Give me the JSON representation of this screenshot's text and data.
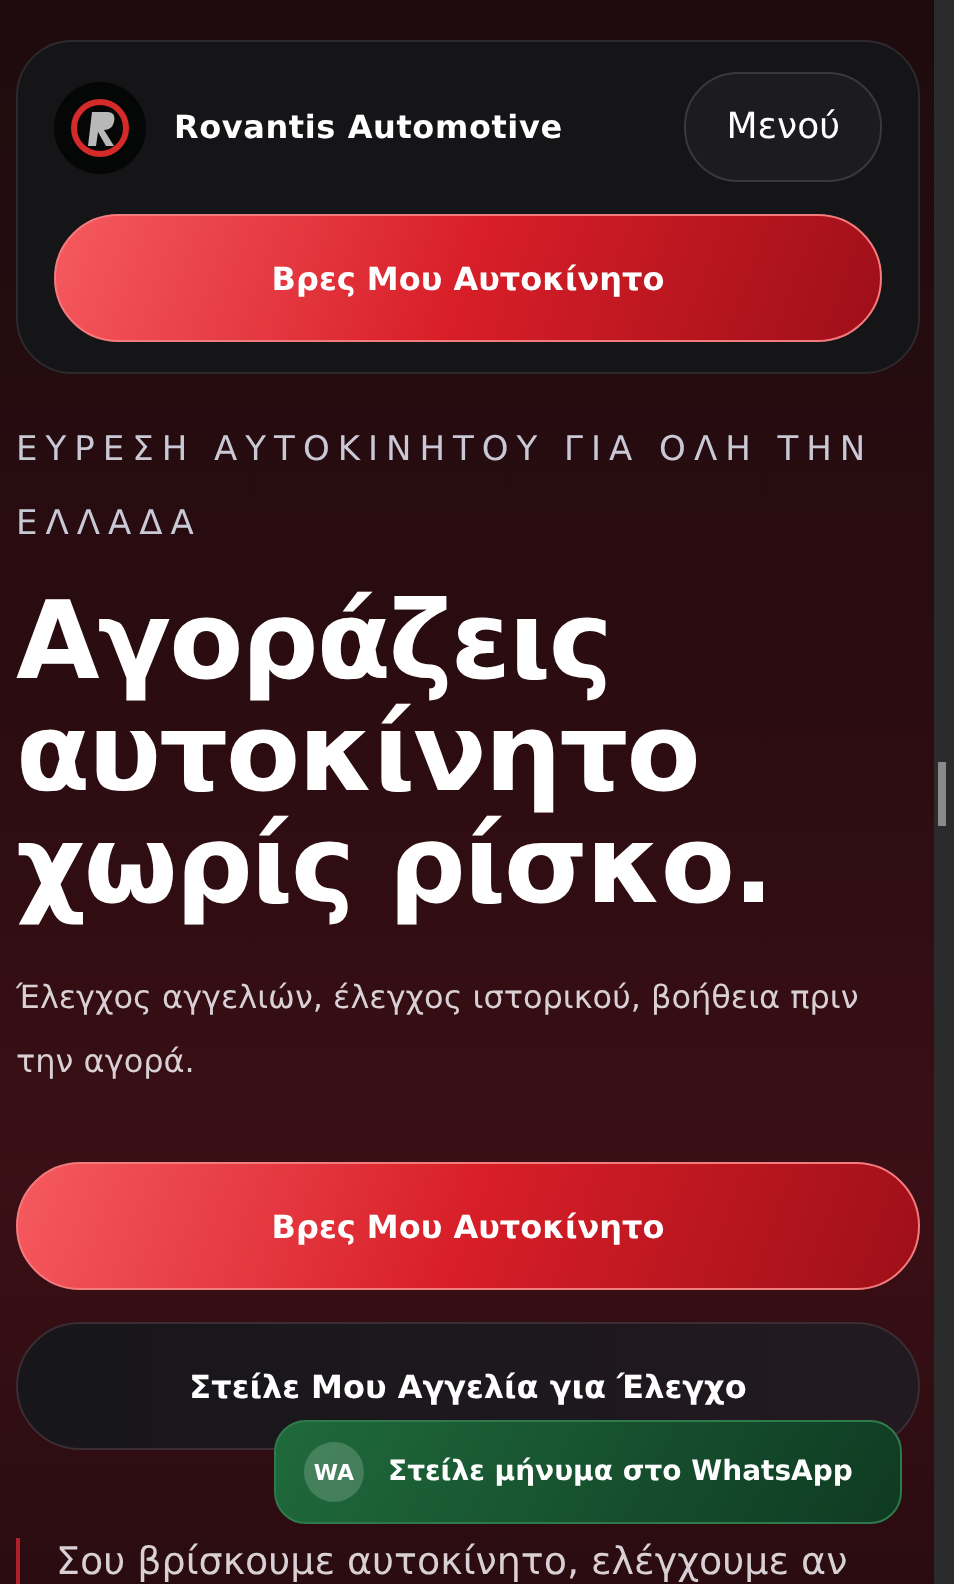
{
  "header": {
    "brand": "Rovantis Automotive",
    "menu_button": "Μενού",
    "cta": "Βρες Μου Αυτοκίνητο"
  },
  "hero": {
    "eyebrow": "ΕΥΡΕΣΗ ΑΥΤΟΚΙΝΗΤΟΥ ΓΙΑ ΟΛΗ ΤΗΝ ΕΛΛΑΔΑ",
    "title_lines": [
      "Αγοράζεις",
      "αυτοκίνητο",
      "χωρίς ρίσκο."
    ],
    "subtitle": "Έλεγχος αγγελιών, έλεγχος ιστορικού, βοήθεια πριν την αγορά.",
    "buttons": [
      {
        "label": "Βρες Μου Αυτοκίνητο",
        "kind": "primary"
      },
      {
        "label": "Στείλε Μου Αγγελία για Έλεγχο",
        "kind": "secondary"
      }
    ],
    "quote": "Σου βρίσκουμε αυτοκίνητο, ελέγχουμε αν"
  },
  "whatsapp": {
    "badge": "WA",
    "label": "Στείλε μήνυμα στο WhatsApp"
  }
}
